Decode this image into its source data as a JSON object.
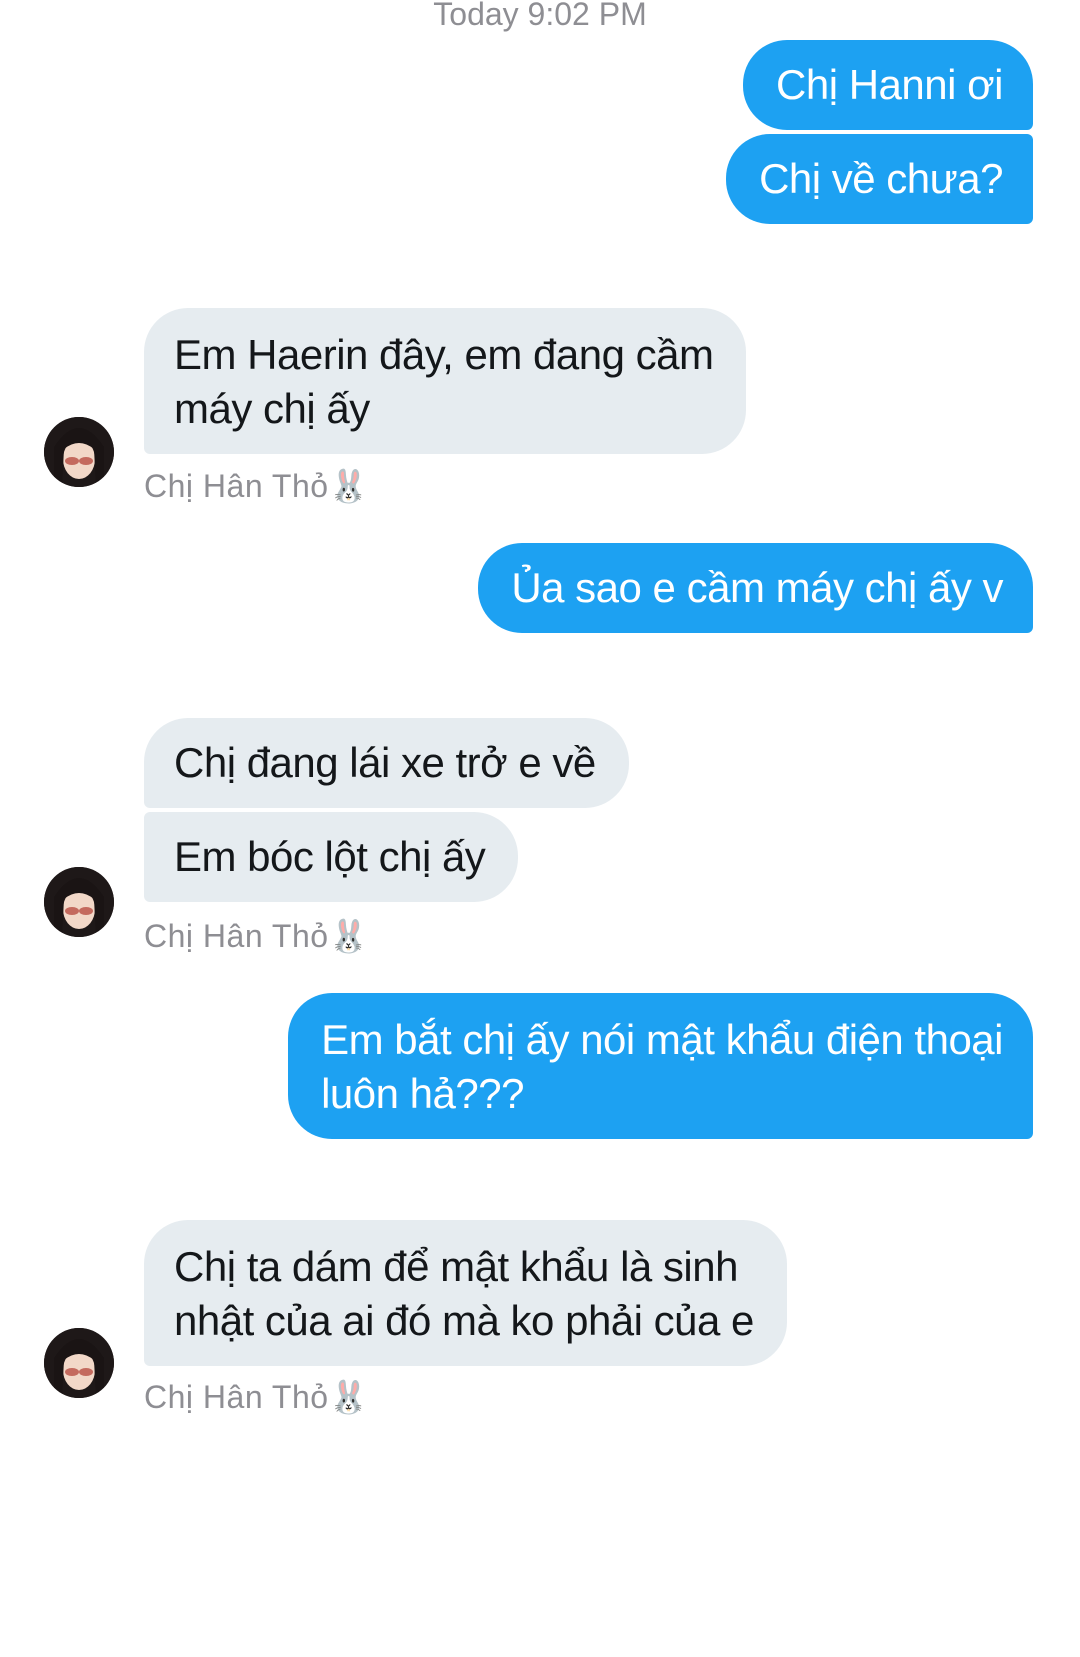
{
  "timestamp": "Today 9:02 PM",
  "messages": [
    {
      "side": "sent",
      "text": "Chị Hanni ơi"
    },
    {
      "side": "sent",
      "text": "Chị về chưa?"
    },
    {
      "side": "received",
      "lines": [
        "Em Haerin đây, em đang cầm",
        "máy chị ấy"
      ]
    },
    {
      "side": "sent",
      "text": "Ủa sao e cầm máy chị ấy v"
    },
    {
      "side": "received",
      "text": "Chị đang lái xe trở e về"
    },
    {
      "side": "received",
      "text": "Em bóc lột chị ấy"
    },
    {
      "side": "sent",
      "lines": [
        "Em bắt chị ấy nói mật khẩu điện thoại",
        "luôn hả???"
      ]
    },
    {
      "side": "received",
      "lines": [
        "Chị ta dám để mật khẩu là sinh",
        "nhật của ai đó mà ko phải của e"
      ]
    }
  ],
  "sender": {
    "name": "Chị Hân Thỏ🐰"
  },
  "colors": {
    "sent_bubble": "#1da1f2",
    "received_bubble": "#e6ecf0",
    "meta_text": "#8e8e93"
  }
}
